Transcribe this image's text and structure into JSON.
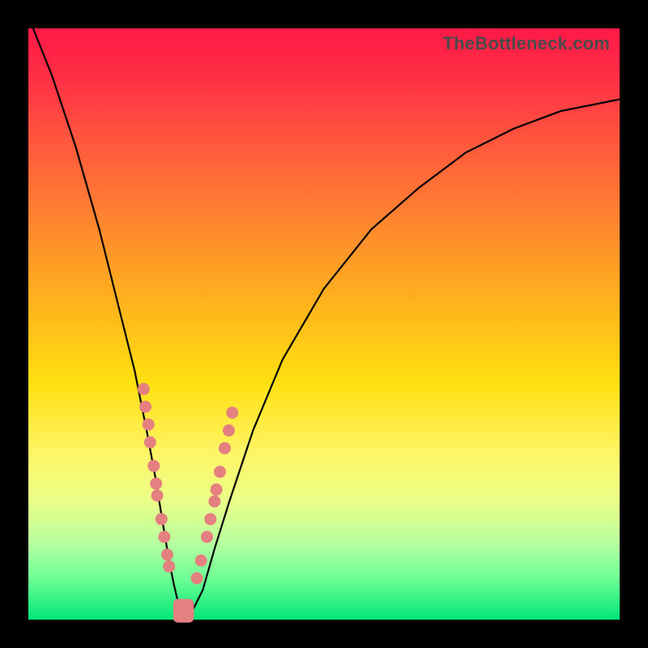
{
  "watermark": "TheBottleneck.com",
  "colors": {
    "gradient_top": "#ff1a47",
    "gradient_bottom": "#00e676",
    "curve": "#000000",
    "points": "#e48080",
    "frame": "#000000"
  },
  "chart_data": {
    "type": "line",
    "title": "",
    "xlabel": "",
    "ylabel": "",
    "xlim": [
      0,
      100
    ],
    "ylim": [
      0,
      100
    ],
    "grid": false,
    "legend": false,
    "series": [
      {
        "name": "bottleneck-curve",
        "x": [
          0,
          4,
          8,
          12,
          15,
          18,
          20,
          21.5,
          22.8,
          23.8,
          24.6,
          25.3,
          26,
          27,
          28,
          29.5,
          31.5,
          34,
          38,
          43,
          50,
          58,
          66,
          74,
          82,
          90,
          100
        ],
        "y": [
          102,
          92,
          80,
          66,
          54,
          42,
          32,
          24,
          16,
          10,
          6,
          3,
          1,
          1,
          2,
          5,
          12,
          20,
          32,
          44,
          56,
          66,
          73,
          79,
          83,
          86,
          88
        ]
      }
    ],
    "points_left_branch": [
      {
        "x": 19.5,
        "y": 39
      },
      {
        "x": 19.8,
        "y": 36
      },
      {
        "x": 20.3,
        "y": 33
      },
      {
        "x": 20.6,
        "y": 30
      },
      {
        "x": 21.2,
        "y": 26
      },
      {
        "x": 21.6,
        "y": 23
      },
      {
        "x": 21.8,
        "y": 21
      },
      {
        "x": 22.5,
        "y": 17
      },
      {
        "x": 23.0,
        "y": 14
      },
      {
        "x": 23.5,
        "y": 11
      },
      {
        "x": 23.8,
        "y": 9
      }
    ],
    "points_right_branch": [
      {
        "x": 28.5,
        "y": 7
      },
      {
        "x": 29.2,
        "y": 10
      },
      {
        "x": 30.2,
        "y": 14
      },
      {
        "x": 30.8,
        "y": 17
      },
      {
        "x": 31.5,
        "y": 20
      },
      {
        "x": 31.8,
        "y": 22
      },
      {
        "x": 32.4,
        "y": 25
      },
      {
        "x": 33.2,
        "y": 29
      },
      {
        "x": 33.9,
        "y": 32
      },
      {
        "x": 34.5,
        "y": 35
      }
    ],
    "bottom_capsule": {
      "x_start": 24.5,
      "x_end": 28.0,
      "y": 1.5,
      "height": 4
    }
  }
}
